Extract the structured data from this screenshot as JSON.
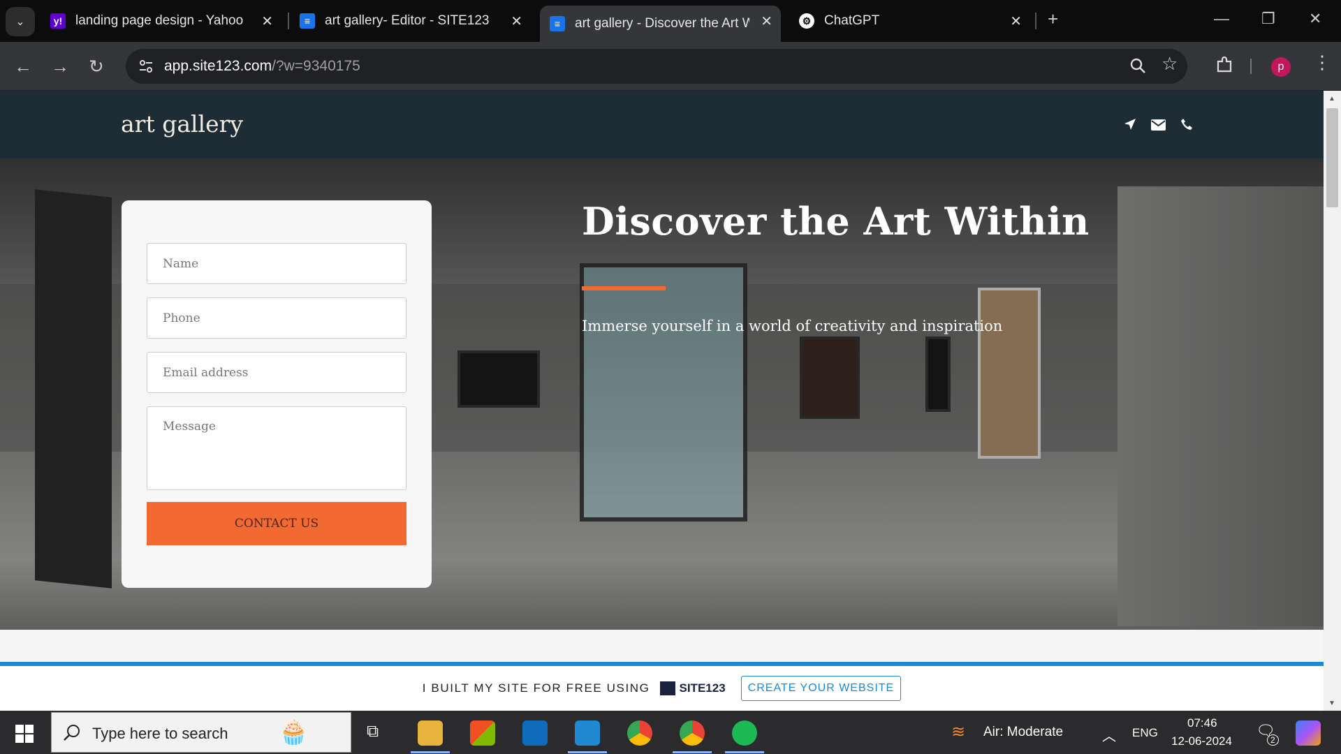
{
  "browser": {
    "tabs": [
      {
        "title": "landing page design - Yahoo In",
        "favicon": "yahoo-icon",
        "active": false
      },
      {
        "title": "art gallery- Editor - SITE123",
        "favicon": "site123-doc-icon",
        "active": false
      },
      {
        "title": "art gallery - Discover the Art Wi",
        "favicon": "site123-doc-icon",
        "active": true
      },
      {
        "title": "ChatGPT",
        "favicon": "chatgpt-icon",
        "active": false
      }
    ],
    "url_host": "app.site123.com",
    "url_path": "/?w=9340175",
    "profile_initial": "p"
  },
  "site": {
    "logo": "art gallery",
    "header_icons": [
      "location-arrow-icon",
      "envelope-icon",
      "phone-icon"
    ],
    "form": {
      "name_placeholder": "Name",
      "phone_placeholder": "Phone",
      "email_placeholder": "Email address",
      "message_placeholder": "Message",
      "submit_label": "CONTACT US"
    },
    "hero": {
      "title": "Discover the Art Within",
      "subtitle": "Immerse yourself in a world of creativity and inspiration"
    },
    "footer_banner": {
      "text": "I BUILT MY SITE FOR FREE USING",
      "brand": "SITE123",
      "cta": "CREATE YOUR WEBSITE"
    }
  },
  "colors": {
    "accent": "#f26a32",
    "header_bg": "#1e2c36",
    "banner_blue": "#1a8ad8"
  },
  "taskbar": {
    "search_placeholder": "Type here to search",
    "weather": "Air: Moderate",
    "language": "ENG",
    "time": "07:46",
    "date": "12-06-2024",
    "notifications": "2"
  }
}
